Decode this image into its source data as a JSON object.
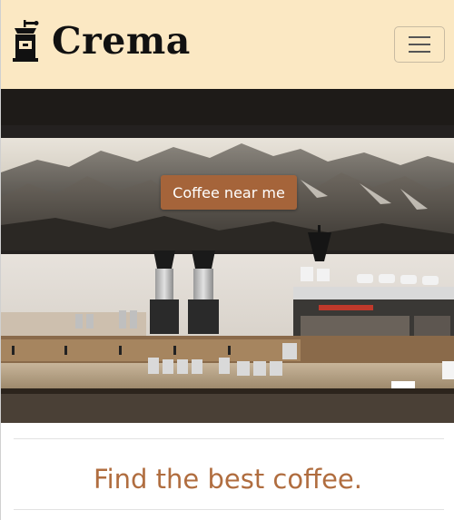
{
  "header": {
    "brand_name": "Crema",
    "brand_icon": "coffee-grinder-icon",
    "menu_icon": "hamburger-menu-icon",
    "background": "#fbe8c3"
  },
  "hero": {
    "image": "coffee-bar-with-mountain-mural",
    "cta_label": "Coffee near me",
    "cta_color": "#a5643a"
  },
  "content": {
    "tagline": "Find the best coffee.",
    "tagline_color": "#b06d3f"
  }
}
